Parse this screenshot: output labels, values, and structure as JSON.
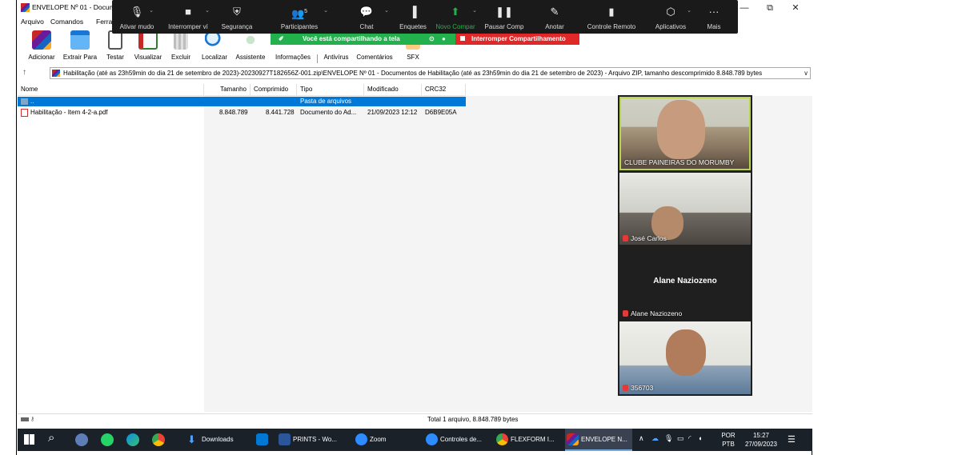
{
  "window": {
    "title": "ENVELOPE Nº 01 - Docume",
    "controls": {
      "minimize": "—",
      "restore": "⧉",
      "close": "✕"
    }
  },
  "menu": [
    "Arquivo",
    "Comandos",
    "Ferrar"
  ],
  "toolbar": [
    {
      "label": "Adicionar",
      "icon": "archive-add-icon",
      "color": "#c62828"
    },
    {
      "label": "Extrair Para",
      "icon": "folder-extract-icon",
      "color": "#1976d2"
    },
    {
      "label": "Testar",
      "icon": "clipboard-test-icon",
      "color": "#c62828"
    },
    {
      "label": "Visualizar",
      "icon": "book-view-icon",
      "color": "#2e7d32"
    },
    {
      "label": "Excluir",
      "icon": "trash-icon",
      "color": "#9e9e9e"
    },
    {
      "label": "Localizar",
      "icon": "magnifier-icon",
      "color": "#1976d2"
    },
    {
      "label": "Assistente",
      "icon": "wand-icon",
      "color": "#43a047"
    },
    {
      "label": "Informações",
      "icon": "info-icon",
      "color": "#1976d2"
    },
    {
      "label": "Antivírus",
      "icon": "antivirus-icon",
      "color": "#43a047"
    },
    {
      "label": "Comentários",
      "icon": "comment-icon",
      "color": "#1976d2"
    },
    {
      "label": "SFX",
      "icon": "sfx-icon",
      "color": "#f9a825"
    }
  ],
  "path": "Habilitação (até as 23h59min do dia 21 de setembro de 2023)-20230927T182656Z-001.zip\\ENVELOPE Nº 01 - Documentos de Habilitação (até as 23h59min do dia 21 de setembro de 2023) - Arquivo ZIP, tamanho descomprimido 8.848.789 bytes",
  "columns": [
    "Nome",
    "Tamanho",
    "Comprimido",
    "Tipo",
    "Modificado",
    "CRC32"
  ],
  "rows": [
    {
      "name": "..",
      "size": "",
      "packed": "",
      "type": "Pasta de arquivos",
      "modified": "",
      "crc": "",
      "selected": true,
      "icon": "folder-up-icon"
    },
    {
      "name": "Habilitação - Item 4-2-a.pdf",
      "size": "8.848.789",
      "packed": "8.441.728",
      "type": "Documento do Ad...",
      "modified": "21/09/2023 12:12",
      "crc": "D6B9E05A",
      "selected": false,
      "icon": "pdf-icon"
    }
  ],
  "status": "Total 1 arquivo, 8.848.789 bytes",
  "zoom": {
    "items": [
      {
        "label": "Ativar mudo",
        "icon": "microphone-icon",
        "glyph": "🎙"
      },
      {
        "label": "Interromper ví",
        "icon": "video-camera-icon",
        "glyph": "■"
      },
      {
        "label": "Segurança",
        "icon": "shield-icon",
        "glyph": "⛨"
      },
      {
        "label": "Participantes",
        "icon": "participants-icon",
        "glyph": "👥",
        "count": "5"
      },
      {
        "label": "Chat",
        "icon": "chat-icon",
        "glyph": "💬"
      },
      {
        "label": "Enquetes",
        "icon": "polls-icon",
        "glyph": "▐"
      },
      {
        "label": "Novo Compar",
        "icon": "new-share-icon",
        "glyph": "⬆"
      },
      {
        "label": "Pausar Comp",
        "icon": "pause-icon",
        "glyph": "❚❚"
      },
      {
        "label": "Anotar",
        "icon": "annotate-pen-icon",
        "glyph": "✎"
      },
      {
        "label": "Controle Remoto",
        "icon": "remote-control-icon",
        "glyph": "▮"
      },
      {
        "label": "Aplicativos",
        "icon": "apps-icon",
        "glyph": "⬡"
      },
      {
        "label": "Mais",
        "icon": "more-icon",
        "glyph": "···"
      }
    ],
    "sharing_text": "Você está compartilhando a tela",
    "stop_sharing": "Interromper Compartilhamento",
    "accent_green": "#23b14d",
    "accent_red": "#e02828"
  },
  "participants": [
    {
      "name": "CLUBE PAINEIRAS DO MORUMBY",
      "muted": false
    },
    {
      "name": "José Carlos",
      "muted": true
    },
    {
      "name": "Alane Naziozeno",
      "display": "Alane Naziozeno",
      "muted": true
    },
    {
      "name": "356703",
      "muted": true
    }
  ],
  "taskbar": {
    "apps": [
      {
        "label": "Downloads",
        "color": "#1e88e5",
        "active": false
      },
      {
        "label": "",
        "color": "#0078d4",
        "active": false
      },
      {
        "label": "PRINTS - Wo...",
        "color": "#2b579a",
        "active": false
      },
      {
        "label": "Zoom",
        "color": "#2d8cff",
        "active": false
      },
      {
        "label": "Controles de...",
        "color": "#2d8cff",
        "active": false
      },
      {
        "label": "FLEXFORM I...",
        "color": "#e53935",
        "active": false
      },
      {
        "label": "ENVELOPE N...",
        "color": "#8e24aa",
        "active": true
      }
    ],
    "lang": "POR",
    "layout": "PTB",
    "time": "15:27",
    "date": "27/09/2023"
  }
}
